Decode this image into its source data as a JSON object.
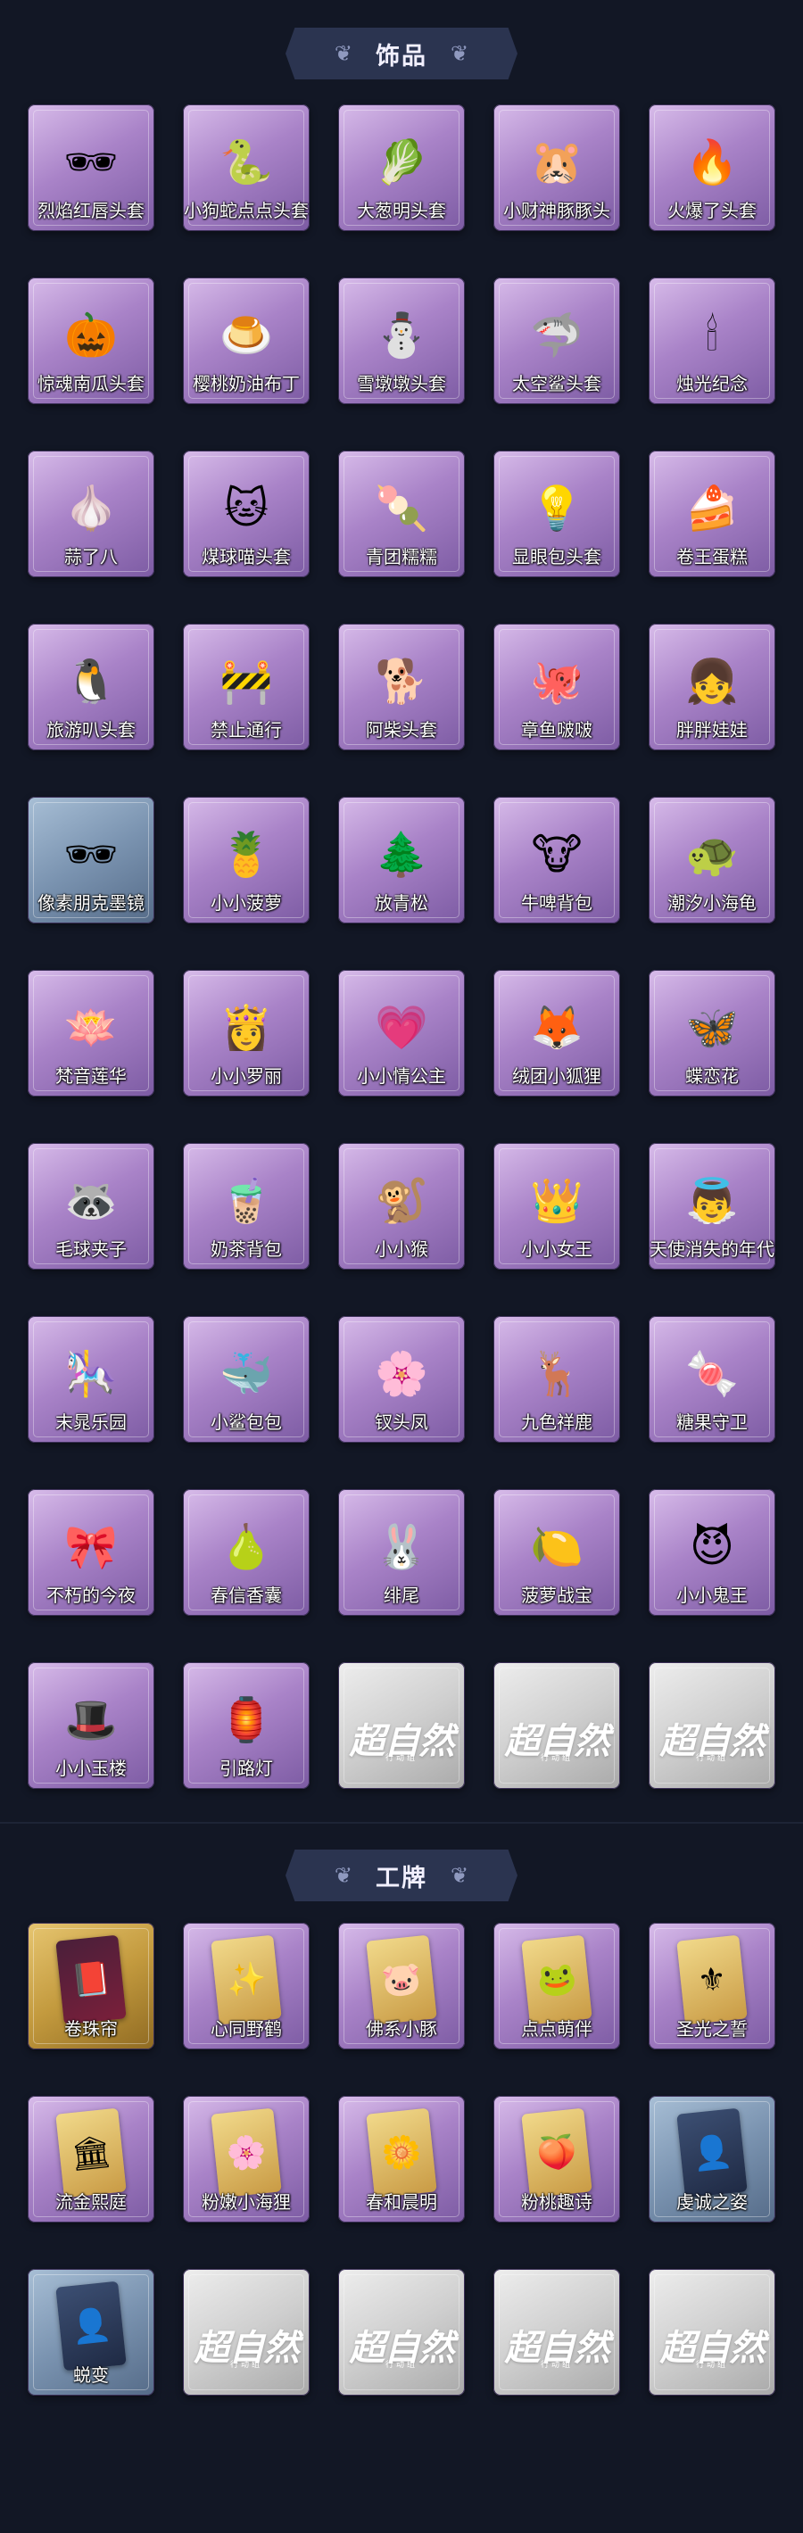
{
  "sections": [
    {
      "title": "饰品",
      "items": [
        {
          "label": "烈焰红唇头套",
          "icon": "🕶",
          "style": "purple"
        },
        {
          "label": "小狗蛇点点头套",
          "icon": "🐍",
          "style": "purple"
        },
        {
          "label": "大葱明头套",
          "icon": "🥬",
          "style": "purple"
        },
        {
          "label": "小财神豚豚头",
          "icon": "🐹",
          "style": "purple"
        },
        {
          "label": "火爆了头套",
          "icon": "🔥",
          "style": "purple"
        },
        {
          "label": "惊魂南瓜头套",
          "icon": "🎃",
          "style": "purple"
        },
        {
          "label": "樱桃奶油布丁",
          "icon": "🍮",
          "style": "purple"
        },
        {
          "label": "雪墩墩头套",
          "icon": "⛄",
          "style": "purple"
        },
        {
          "label": "太空鲨头套",
          "icon": "🦈",
          "style": "purple"
        },
        {
          "label": "烛光纪念",
          "icon": "🕯",
          "style": "purple"
        },
        {
          "label": "蒜了八",
          "icon": "🧄",
          "style": "purple"
        },
        {
          "label": "煤球喵头套",
          "icon": "🐱",
          "style": "purple"
        },
        {
          "label": "青团糯糯",
          "icon": "🍡",
          "style": "purple"
        },
        {
          "label": "显眼包头套",
          "icon": "💡",
          "style": "purple"
        },
        {
          "label": "卷王蛋糕",
          "icon": "🍰",
          "style": "purple"
        },
        {
          "label": "旅游叭头套",
          "icon": "🐧",
          "style": "purple"
        },
        {
          "label": "禁止通行",
          "icon": "🚧",
          "style": "purple"
        },
        {
          "label": "阿柴头套",
          "icon": "🐕",
          "style": "purple"
        },
        {
          "label": "章鱼啵啵",
          "icon": "🐙",
          "style": "purple"
        },
        {
          "label": "胖胖娃娃",
          "icon": "👧",
          "style": "purple"
        },
        {
          "label": "像素朋克墨镜",
          "icon": "🕶",
          "style": "blue"
        },
        {
          "label": "小小菠萝",
          "icon": "🍍",
          "style": "purple"
        },
        {
          "label": "放青松",
          "icon": "🌲",
          "style": "purple"
        },
        {
          "label": "牛啤背包",
          "icon": "🐮",
          "style": "purple"
        },
        {
          "label": "潮汐小海龟",
          "icon": "🐢",
          "style": "purple"
        },
        {
          "label": "梵音莲华",
          "icon": "🪷",
          "style": "purple"
        },
        {
          "label": "小小罗丽",
          "icon": "👸",
          "style": "purple"
        },
        {
          "label": "小小情公主",
          "icon": "💗",
          "style": "purple"
        },
        {
          "label": "绒团小狐狸",
          "icon": "🦊",
          "style": "purple"
        },
        {
          "label": "蝶恋花",
          "icon": "🦋",
          "style": "purple"
        },
        {
          "label": "毛球夹子",
          "icon": "🦝",
          "style": "purple"
        },
        {
          "label": "奶茶背包",
          "icon": "🧋",
          "style": "purple"
        },
        {
          "label": "小小猴",
          "icon": "🐒",
          "style": "purple"
        },
        {
          "label": "小小女王",
          "icon": "👑",
          "style": "purple"
        },
        {
          "label": "天使消失的年代",
          "icon": "👼",
          "style": "purple"
        },
        {
          "label": "末晁乐园",
          "icon": "🎠",
          "style": "purple"
        },
        {
          "label": "小鲨包包",
          "icon": "🐳",
          "style": "purple"
        },
        {
          "label": "钗头凤",
          "icon": "🌸",
          "style": "purple"
        },
        {
          "label": "九色祥鹿",
          "icon": "🦌",
          "style": "purple"
        },
        {
          "label": "糖果守卫",
          "icon": "🍬",
          "style": "purple"
        },
        {
          "label": "不朽的今夜",
          "icon": "🎀",
          "style": "purple"
        },
        {
          "label": "春信香囊",
          "icon": "🍐",
          "style": "purple"
        },
        {
          "label": "绯尾",
          "icon": "🐰",
          "style": "purple"
        },
        {
          "label": "菠萝战宝",
          "icon": "🍋",
          "style": "purple"
        },
        {
          "label": "小小鬼王",
          "icon": "😈",
          "style": "purple"
        },
        {
          "label": "小小玉楼",
          "icon": "🎩",
          "style": "purple"
        },
        {
          "label": "引路灯",
          "icon": "🏮",
          "style": "purple"
        },
        {
          "label": "",
          "icon": "",
          "style": "empty"
        },
        {
          "label": "",
          "icon": "",
          "style": "empty"
        },
        {
          "label": "",
          "icon": "",
          "style": "empty"
        }
      ]
    },
    {
      "title": "工牌",
      "items": [
        {
          "label": "卷珠帘",
          "icon": "📕",
          "style": "gold"
        },
        {
          "label": "心同野鹤",
          "icon": "✨",
          "style": "purple"
        },
        {
          "label": "佛系小豚",
          "icon": "🐷",
          "style": "purple"
        },
        {
          "label": "点点萌伴",
          "icon": "🐸",
          "style": "purple"
        },
        {
          "label": "圣光之誓",
          "icon": "⚜",
          "style": "purple"
        },
        {
          "label": "流金熙庭",
          "icon": "🏛",
          "style": "purple"
        },
        {
          "label": "粉嫩小海狸",
          "icon": "🌸",
          "style": "purple"
        },
        {
          "label": "春和晨明",
          "icon": "🌼",
          "style": "purple"
        },
        {
          "label": "粉桃趣诗",
          "icon": "🍑",
          "style": "purple"
        },
        {
          "label": "虔诚之姿",
          "icon": "👤",
          "style": "blue"
        },
        {
          "label": "蜕变",
          "icon": "👤",
          "style": "blue"
        },
        {
          "label": "",
          "icon": "",
          "style": "empty"
        },
        {
          "label": "",
          "icon": "",
          "style": "empty"
        },
        {
          "label": "",
          "icon": "",
          "style": "empty"
        },
        {
          "label": "",
          "icon": "",
          "style": "empty"
        }
      ]
    }
  ],
  "empty_card": {
    "logo_text": "超自然",
    "sub_text": "行动组"
  },
  "banner_ornament": "❦"
}
